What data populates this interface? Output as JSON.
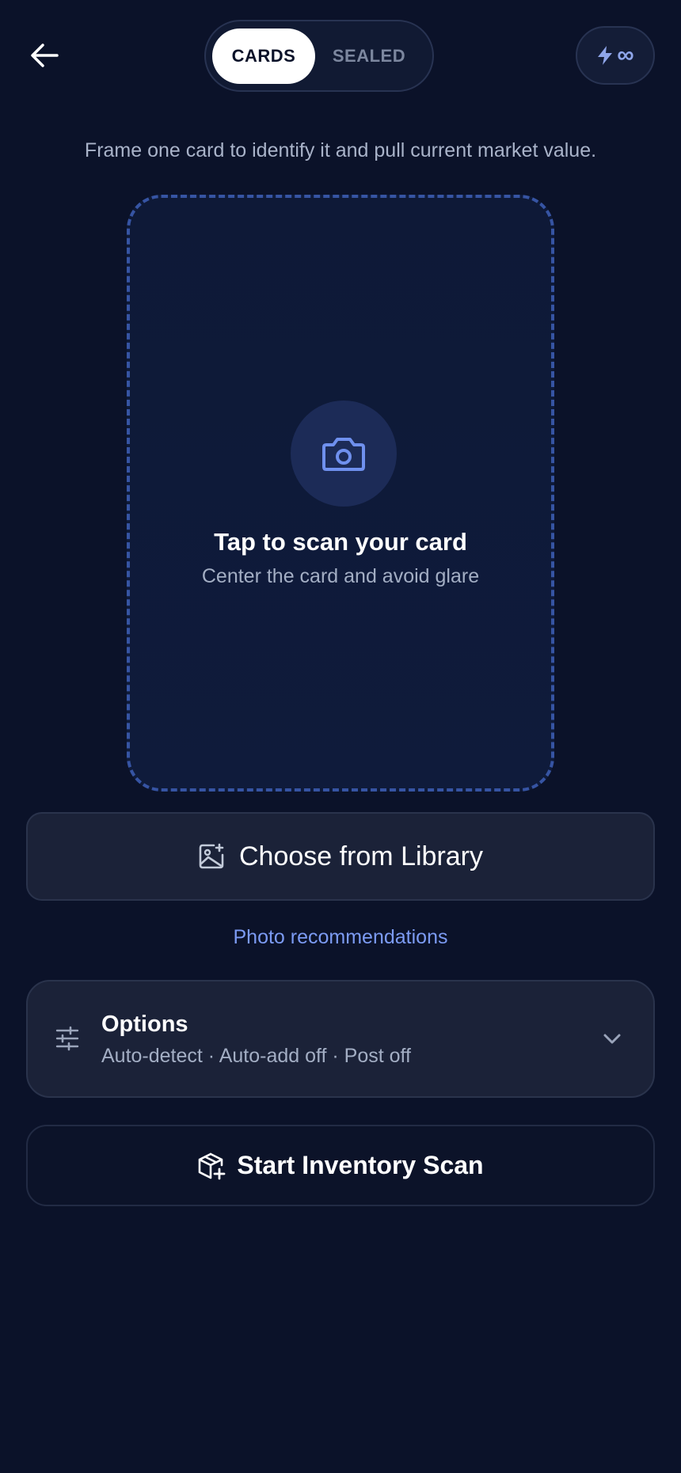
{
  "header": {
    "back_icon": "arrow-left-icon",
    "tabs": [
      {
        "label": "CARDS",
        "active": true
      },
      {
        "label": "SEALED",
        "active": false
      }
    ],
    "quota": {
      "icon": "lightning-bolt-icon",
      "value": "∞"
    }
  },
  "subtitle": "Frame one card to identify it and pull current market value.",
  "scan": {
    "icon": "camera-icon",
    "title": "Tap to scan your card",
    "hint": "Center the card and avoid glare"
  },
  "library_button": {
    "icon": "image-add-icon",
    "label": "Choose from Library"
  },
  "photo_recommendations": "Photo recommendations",
  "options": {
    "icon": "sliders-icon",
    "title": "Options",
    "summary": "Auto-detect · Auto-add off · Post off",
    "chevron": "chevron-down-icon"
  },
  "inventory_button": {
    "icon": "package-plus-icon",
    "label": "Start Inventory Scan"
  },
  "colors": {
    "background": "#0b1229",
    "accent": "#7c9bf3",
    "frame_dash": "#3654a3",
    "card": "#1b2238"
  }
}
